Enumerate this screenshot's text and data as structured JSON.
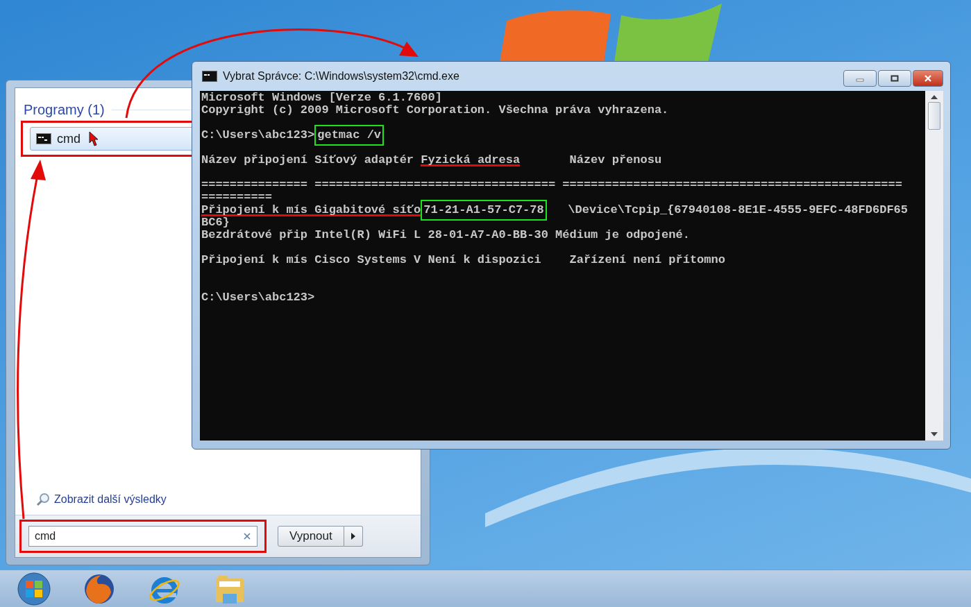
{
  "start_menu": {
    "section_title": "Programy (1)",
    "results": [
      {
        "label": "cmd",
        "selected": true,
        "highlighted": true,
        "arrow_to_console": true
      }
    ],
    "more_results_link": "Zobrazit další výsledky",
    "search": {
      "value": "cmd",
      "highlighted": true,
      "arrow_to_result": true
    },
    "shutdown_button": "Vypnout"
  },
  "cmd_window": {
    "title": "Vybrat Správce: C:\\Windows\\system32\\cmd.exe",
    "lines": [
      {
        "kind": "text",
        "segments": [
          {
            "text": "Microsoft Windows [Verze 6.1.7600]",
            "kind": "plain"
          }
        ]
      },
      {
        "kind": "text",
        "segments": [
          {
            "text": "Copyright (c) 2009 Microsoft Corporation. Všechna práva vyhrazena.",
            "kind": "plain"
          }
        ]
      },
      {
        "kind": "blank"
      },
      {
        "kind": "text",
        "segments": [
          {
            "text": "C:\\Users\\abc123>",
            "kind": "plain"
          },
          {
            "text": "getmac /v",
            "kind": "boxed"
          }
        ]
      },
      {
        "kind": "blank"
      },
      {
        "kind": "text",
        "segments": [
          {
            "text": "Název připojení Síťový adaptér ",
            "kind": "plain"
          },
          {
            "text": "Fyzická adresa",
            "kind": "underlined"
          },
          {
            "text": "       Název přenosu",
            "kind": "plain"
          }
        ]
      },
      {
        "kind": "blank"
      },
      {
        "kind": "text",
        "segments": [
          {
            "text": "=============== ================================== ================================================",
            "kind": "plain"
          }
        ]
      },
      {
        "kind": "text",
        "segments": [
          {
            "text": "==========",
            "kind": "plain"
          }
        ]
      },
      {
        "kind": "text",
        "segments": [
          {
            "text": "Připojení k mís Gigabitové síťo",
            "kind": "underlined"
          },
          {
            "text": "71-21-A1-57-C7-78",
            "kind": "boxed"
          },
          {
            "text": "   \\Device\\Tcpip_{67940108-8E1E-4555-9EFC-48FD6DF65",
            "kind": "plain"
          }
        ]
      },
      {
        "kind": "text",
        "segments": [
          {
            "text": "BC6}",
            "kind": "plain"
          }
        ]
      },
      {
        "kind": "text",
        "segments": [
          {
            "text": "Bezdrátové přip Intel(R) WiFi L 28-01-A7-A0-BB-30 Médium je odpojené.",
            "kind": "plain"
          }
        ]
      },
      {
        "kind": "blank"
      },
      {
        "kind": "text",
        "segments": [
          {
            "text": "Připojení k mís Cisco Systems V Není k dispozici    Zařízení není přítomno",
            "kind": "plain"
          }
        ]
      },
      {
        "kind": "blank"
      },
      {
        "kind": "blank"
      },
      {
        "kind": "text",
        "segments": [
          {
            "text": "C:\\Users\\abc123>",
            "kind": "plain"
          }
        ]
      }
    ]
  }
}
